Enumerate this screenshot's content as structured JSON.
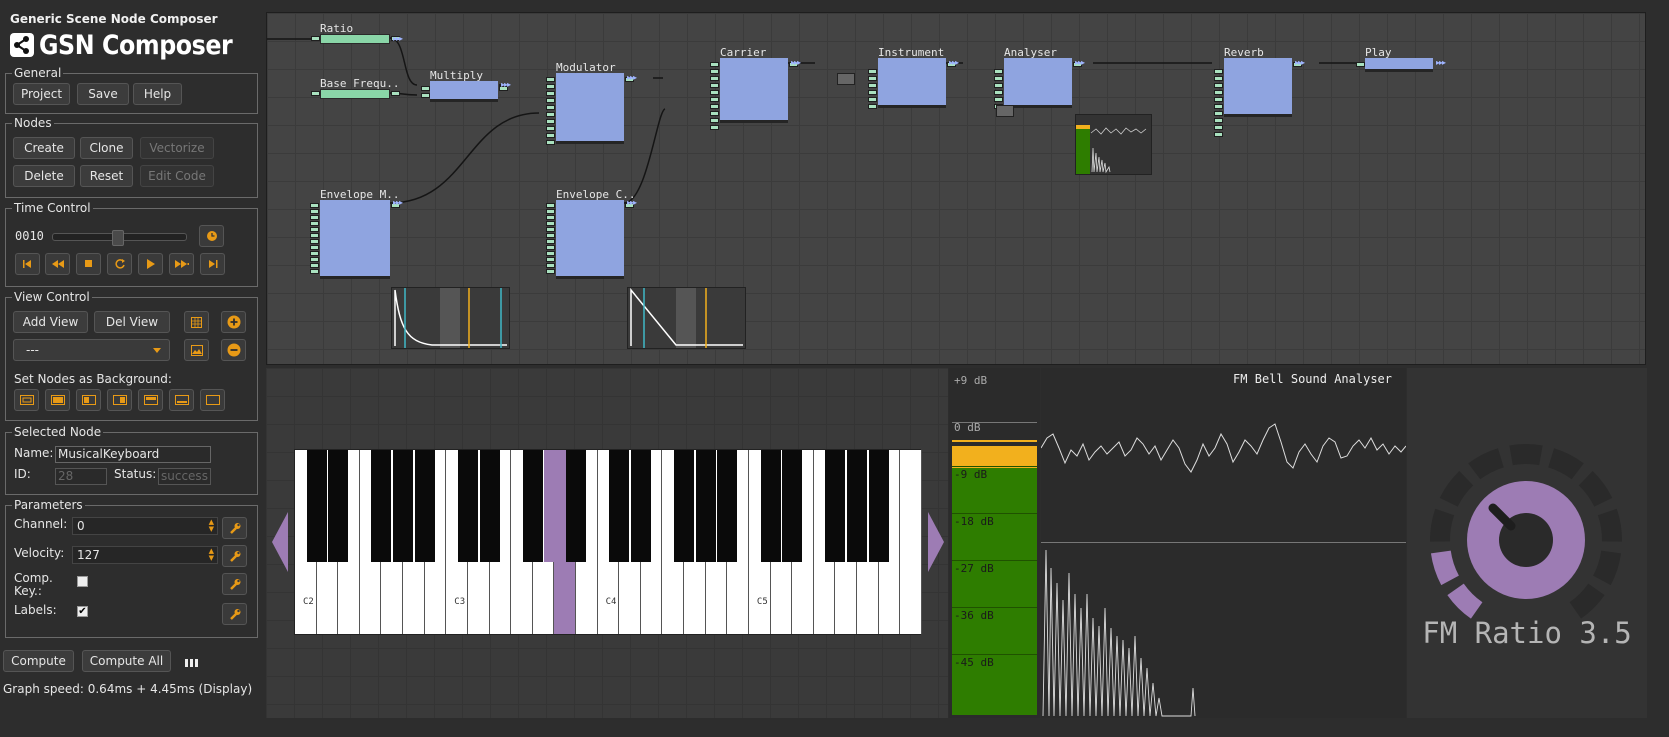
{
  "app": {
    "title": "Generic Scene Node Composer",
    "logo_text": "GSN Composer"
  },
  "general": {
    "legend": "General",
    "buttons": [
      "Project",
      "Save",
      "Help"
    ]
  },
  "nodes": {
    "legend": "Nodes",
    "create": "Create",
    "clone": "Clone",
    "vectorize": "Vectorize",
    "delete": "Delete",
    "reset": "Reset",
    "edit_code": "Edit Code"
  },
  "time_control": {
    "legend": "Time Control",
    "frame": "0010",
    "slider_fraction": 0.48,
    "buttons_icons": [
      "skip-start-icon",
      "rewind-icon",
      "stop-icon",
      "loop-icon",
      "play-icon",
      "fast-forward-icon",
      "skip-end-icon"
    ]
  },
  "view_control": {
    "legend": "View Control",
    "add_view": "Add View",
    "del_view": "Del View",
    "view_select": "---",
    "background_label": "Set Nodes as Background:"
  },
  "selected_node": {
    "legend": "Selected Node",
    "name_label": "Name:",
    "name": "MusicalKeyboard",
    "id_label": "ID:",
    "id": "28",
    "status_label": "Status:",
    "status": "success"
  },
  "parameters": {
    "legend": "Parameters",
    "channel_label": "Channel:",
    "channel": "0",
    "velocity_label": "Velocity:",
    "velocity": "127",
    "comp_key_label_1": "Comp.",
    "comp_key_label_2": "Key.:",
    "comp_key_checked": false,
    "labels_label": "Labels:",
    "labels_checked": true
  },
  "bottom": {
    "compute": "Compute",
    "compute_all": "Compute All",
    "graph_speed": "Graph speed: 0.64ms + 4.45ms (Display)"
  },
  "graph_nodes": {
    "ratio": "Ratio",
    "base_freq": "Base Frequ..",
    "multiply": "Multiply",
    "modulator": "Modulator",
    "carrier": "Carrier",
    "instrument": "Instrument",
    "analyser": "Analyser",
    "reverb": "Reverb",
    "play": "Play",
    "env_m": "Envelope M..",
    "env_c": "Envelope C.."
  },
  "keyboard": {
    "labels": [
      "C2",
      "C3",
      "C4",
      "C5"
    ],
    "selected_white_key_index": 12
  },
  "meter": {
    "ticks": [
      "+9 dB",
      "0 dB",
      "-9 dB",
      "-18 dB",
      "-27 dB",
      "-36 dB",
      "-45 dB"
    ],
    "colors": {
      "green": "#2e7d00",
      "orange": "#f2b01d"
    }
  },
  "analyser": {
    "title": "FM Bell Sound Analyser"
  },
  "knob": {
    "label": "FM Ratio 3.5",
    "accent": "#9d7cb4"
  }
}
